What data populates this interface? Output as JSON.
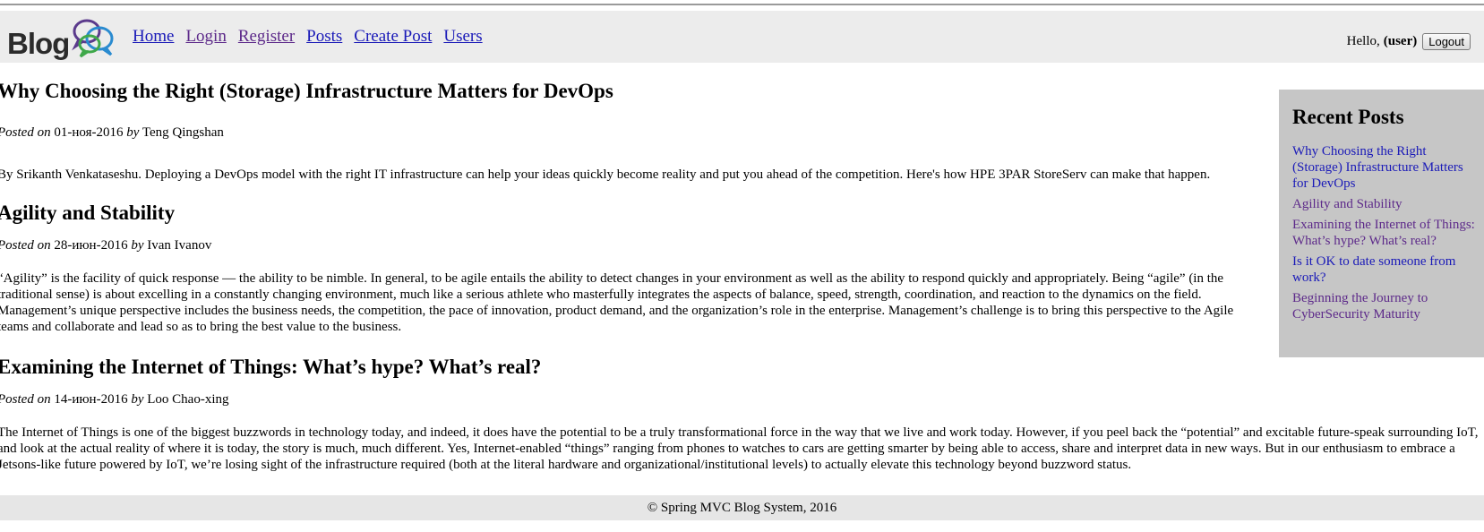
{
  "logo": {
    "text": "Blog",
    "icon": "speech-bubbles-icon"
  },
  "nav": {
    "items": [
      {
        "label": "Home",
        "visited": false
      },
      {
        "label": "Login",
        "visited": true
      },
      {
        "label": "Register",
        "visited": true
      },
      {
        "label": "Posts",
        "visited": false
      },
      {
        "label": "Create Post",
        "visited": false
      },
      {
        "label": "Users",
        "visited": false
      }
    ]
  },
  "user": {
    "greeting": "Hello,",
    "name": "(user)",
    "logout_label": "Logout"
  },
  "posts": [
    {
      "title": "Why Choosing the Right (Storage) Infrastructure Matters for DevOps",
      "posted_on_label": "Posted on",
      "date": "01-ноя-2016",
      "by_label": "by",
      "author": "Teng Qingshan",
      "body": "By Srikanth Venkataseshu. Deploying a DevOps model with the right IT infrastructure can help your ideas quickly become reality and put you ahead of the competition. Here's how HPE 3PAR StoreServ can make that happen."
    },
    {
      "title": "Agility and Stability",
      "posted_on_label": "Posted on",
      "date": "28-июн-2016",
      "by_label": "by",
      "author": "Ivan Ivanov",
      "body": "“Agility” is the facility of quick response — the ability to be nimble. In general, to be agile entails the ability to detect changes in your environment as well as the ability to respond quickly and appropriately. Being “agile” (in the traditional sense) is about excelling in a constantly changing environment, much like a serious athlete who masterfully integrates the aspects of balance, speed, strength, coordination, and reaction to the dynamics on the field. Management’s unique perspective includes the business needs, the competition, the pace of innovation, product demand, and the organization’s role in the enterprise. Management’s challenge is to bring this perspective to the Agile teams and collaborate and lead so as to bring the best value to the business."
    },
    {
      "title": "Examining the Internet of Things: What’s hype? What’s real?",
      "posted_on_label": "Posted on",
      "date": "14-июн-2016",
      "by_label": "by",
      "author": "Loo Chao-xing",
      "body": "The Internet of Things is one of the biggest buzzwords in technology today, and indeed, it does have the potential to be a truly transformational force in the way that we live and work today. However, if you peel back the “potential” and excitable future-speak surrounding IoT, and look at the actual reality of where it is today, the story is much, much different. Yes, Internet-enabled “things” ranging from phones to watches to cars are getting smarter by being able to access, share and interpret data in new ways. But in our enthusiasm to embrace a Jetsons-like future powered by IoT, we’re losing sight of the infrastructure required (both at the literal hardware and organizational/institutional levels) to actually elevate this technology beyond buzzword status."
    }
  ],
  "sidebar": {
    "title": "Recent Posts",
    "items": [
      {
        "label": "Why Choosing the Right (Storage) Infrastructure Matters for DevOps",
        "visited": false
      },
      {
        "label": "Agility and Stability",
        "visited": true
      },
      {
        "label": "Examining the Internet of Things: What’s hype? What’s real?",
        "visited": true
      },
      {
        "label": "Is it OK to date someone from work?",
        "visited": false
      },
      {
        "label": "Beginning the Journey to CyberSecurity Maturity",
        "visited": true
      }
    ]
  },
  "footer": {
    "text": "© Spring MVC Blog System, 2016"
  },
  "colors": {
    "link": "#1a1ab8",
    "visited_link": "#5d2a8a",
    "header_bg": "#ececec",
    "sidebar_bg": "#c6c6c6",
    "footer_bg": "#e6e6e6"
  }
}
